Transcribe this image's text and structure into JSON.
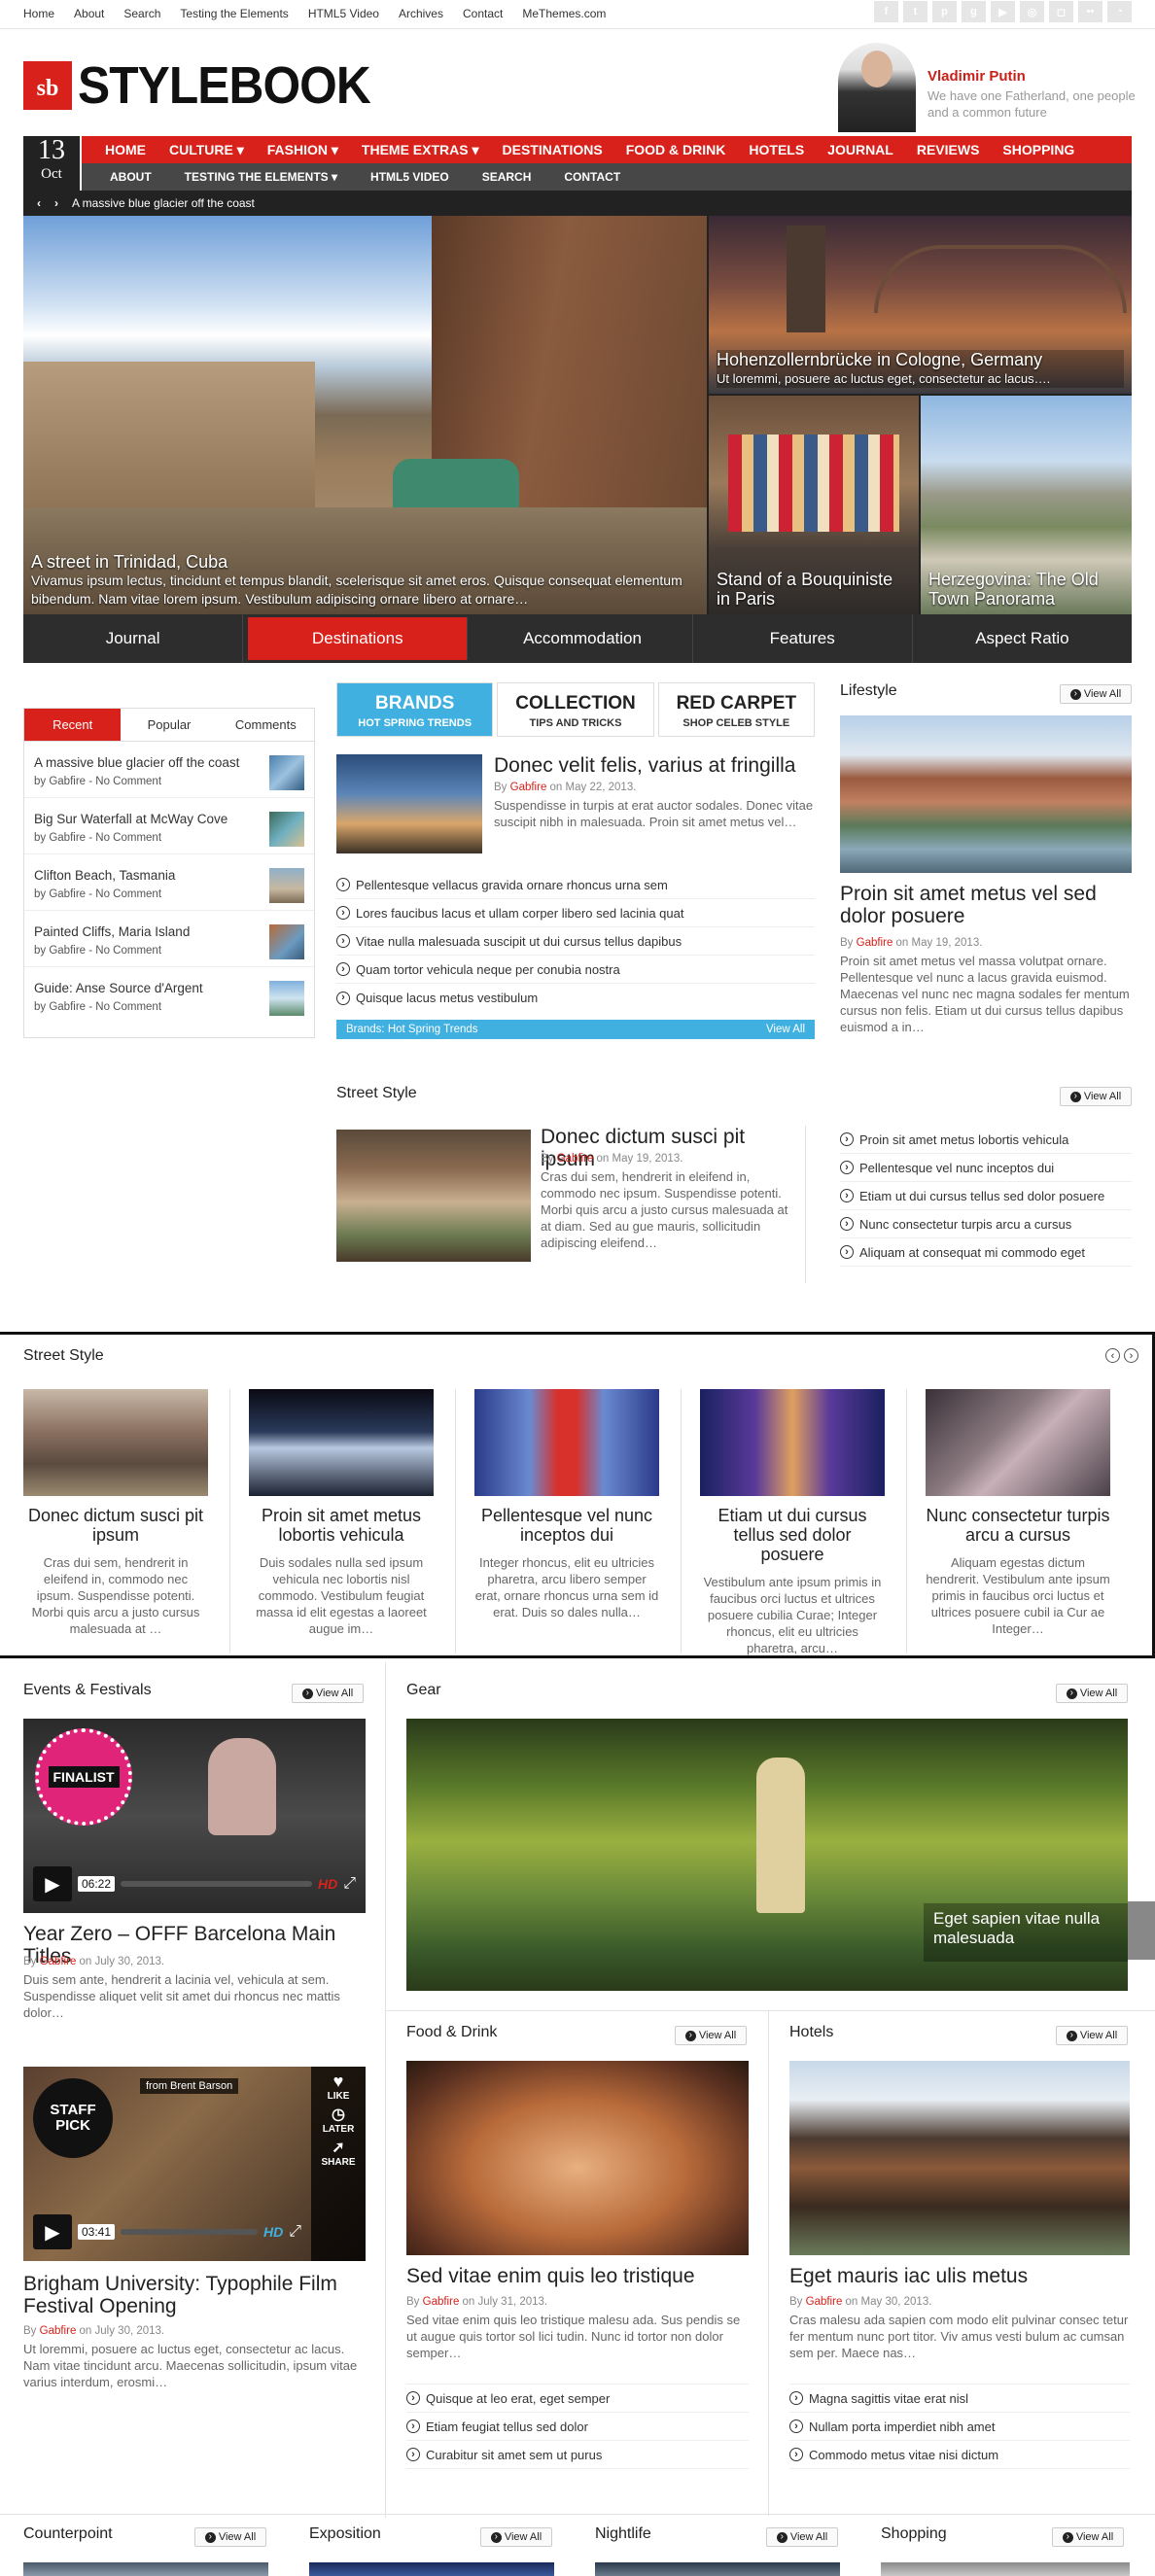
{
  "topbar": {
    "links": [
      "Home",
      "About",
      "Search",
      "Testing the Elements",
      "HTML5 Video",
      "Archives",
      "Contact",
      "MeThemes.com"
    ],
    "social_icons": [
      "facebook-icon",
      "twitter-icon",
      "pinterest-icon",
      "google-plus-icon",
      "youtube-icon",
      "dribbble-icon",
      "instagram-icon",
      "flickr-icon",
      "rss-icon"
    ]
  },
  "logo": {
    "mark": "sb",
    "text": "STYLEBOOK"
  },
  "quote": {
    "name": "Vladimir Putin",
    "text": "We have one Fatherland, one people and a common future"
  },
  "date": {
    "day": "13",
    "month": "Oct"
  },
  "nav": {
    "primary": [
      "HOME",
      "CULTURE ▾",
      "FASHION ▾",
      "THEME EXTRAS ▾",
      "DESTINATIONS",
      "FOOD & DRINK",
      "HOTELS",
      "JOURNAL",
      "REVIEWS",
      "SHOPPING"
    ],
    "secondary": [
      "ABOUT",
      "TESTING THE ELEMENTS ▾",
      "HTML5 VIDEO",
      "SEARCH",
      "CONTACT"
    ]
  },
  "ticker": {
    "prev": "‹",
    "next": "›",
    "text": "A massive blue glacier off the coast"
  },
  "slider": {
    "main": {
      "title": "A street in Trinidad, Cuba",
      "text": "Vivamus ipsum lectus, tincidunt et tempus blandit, scelerisque sit amet eros. Quisque consequat elementum bibendum. Nam vitae lorem ipsum. Vestibulum adipiscing ornare libero at ornare…"
    },
    "top_right": {
      "title": "Hohenzollernbrücke in Cologne, Germany",
      "text": "Ut loremmi, posuere ac luctus eget, consectetur ac lacus…."
    },
    "bottom_left": {
      "title": "Stand of a Bouquiniste in Paris"
    },
    "bottom_right": {
      "title": "Herzegovina: The Old Town Panorama"
    },
    "tabs": [
      "Journal",
      "Destinations",
      "Accommodation",
      "Features",
      "Aspect Ratio"
    ]
  },
  "sidebar": {
    "tabs": [
      "Recent",
      "Popular",
      "Comments"
    ],
    "items": [
      {
        "title": "A massive blue glacier off the coast",
        "meta": "by Gabfire - No Comment"
      },
      {
        "title": "Big Sur Waterfall at McWay Cove",
        "meta": "by Gabfire - No Comment"
      },
      {
        "title": "Clifton Beach, Tasmania",
        "meta": "by Gabfire - No Comment"
      },
      {
        "title": "Painted Cliffs, Maria Island",
        "meta": "by Gabfire - No Comment"
      },
      {
        "title": "Guide: Anse Source d'Argent",
        "meta": "by Gabfire - No Comment"
      }
    ]
  },
  "brands": {
    "tabs": [
      {
        "title": "BRANDS",
        "sub": "HOT SPRING TRENDS"
      },
      {
        "title": "COLLECTION",
        "sub": "TIPS AND TRICKS"
      },
      {
        "title": "RED CARPET",
        "sub": "SHOP CELEB STYLE"
      }
    ],
    "post": {
      "title": "Donec velit felis, varius at fringilla",
      "by": "By ",
      "author": "Gabfire",
      "date": " on May 22, 2013.",
      "excerpt": "Suspendisse in turpis at erat auctor sodales. Donec vitae suscipit nibh in malesuada. Proin sit amet metus vel…"
    },
    "bullets": [
      "Pellentesque vellacus gravida ornare rhoncus urna sem",
      "Lores faucibus lacus et ullam corper libero sed lacinia quat",
      "Vitae nulla malesuada suscipit ut dui cursus tellus dapibus",
      "Quam tortor vehicula neque per conubia nostra",
      "Quisque lacus metus vestibulum"
    ],
    "bar_label": "Brands: Hot Spring Trends",
    "bar_link": "View All"
  },
  "lifestyle": {
    "heading": "Lifestyle",
    "view_all": "View All",
    "title": "Proin sit amet metus vel sed dolor posuere",
    "by": "By ",
    "author": "Gabfire",
    "date": " on May 19, 2013.",
    "excerpt": "Proin sit amet metus vel massa volutpat ornare. Pellentesque vel nunc a lacus gravida euismod. Maecenas vel nunc nec magna sodales fer mentum cursus non felis. Etiam ut dui cursus tellus dapibus euismod a in…"
  },
  "street": {
    "heading": "Street Style",
    "view_all": "View All",
    "title": "Donec dictum susci pit ipsum",
    "by": "By ",
    "author": "Gabfire",
    "date": " on May 19, 2013.",
    "excerpt": "Cras dui sem, hendrerit in eleifend in, commodo nec ipsum. Suspendisse potenti. Morbi quis arcu a justo cursus malesuada at at diam. Sed au gue mauris, sollicitudin adipiscing eleifend…",
    "bullets": [
      "Proin sit amet metus lobortis vehicula",
      "Pellentesque vel nunc inceptos dui",
      "Etiam ut dui cursus tellus sed dolor posuere",
      "Nunc consectetur turpis arcu a cursus",
      "Aliquam at consequat mi commodo eget"
    ]
  },
  "carousel": {
    "heading": "Street Style",
    "items": [
      {
        "title": "Donec dictum susci pit ipsum",
        "text": "Cras dui sem, hendrerit in eleifend in, commodo nec ipsum. Suspendisse potenti. Morbi quis arcu a justo cursus malesuada at …"
      },
      {
        "title": "Proin sit amet metus lobortis vehicula",
        "text": "Duis sodales nulla sed ipsum vehicula nec lobortis nisl commodo. Vestibulum feugiat massa id elit egestas a laoreet augue im…"
      },
      {
        "title": "Pellentesque vel nunc inceptos dui",
        "text": "Integer rhoncus, elit eu ultricies pharetra, arcu libero semper erat, ornare rhoncus urna sem id erat. Duis so dales nulla…"
      },
      {
        "title": "Etiam ut dui cursus tellus sed dolor posuere",
        "text": "Vestibulum ante ipsum primis in faucibus orci luctus et ultrices posuere cubilia Curae; Integer rhoncus, elit eu ultricies pharetra, arcu…"
      },
      {
        "title": "Nunc consectetur turpis arcu a cursus",
        "text": "Aliquam egestas dictum hendrerit. Vestibulum ante ipsum primis in faucibus orci luctus et ultrices posuere cubil ia Cur ae Integer…"
      }
    ]
  },
  "events": {
    "heading": "Events & Festivals",
    "view_all": "View All",
    "video1": {
      "badge": "FINALIST",
      "time": "06:22",
      "hd": "HD",
      "title": "Year Zero – OFFF Barcelona Main Titles",
      "by": "By ",
      "author": "Gabfire",
      "date": " on July 30, 2013.",
      "excerpt": "Duis sem ante, hendrerit a lacinia vel, vehicula at sem. Suspendisse aliquet velit sit amet dui rhoncus nec mattis dolor…"
    },
    "video2": {
      "badge": "STAFF PICK",
      "from": "from Brent Barson",
      "like": "LIKE",
      "later": "LATER",
      "share": "SHARE",
      "time": "03:41",
      "hd": "HD",
      "title": "Brigham University: Typophile Film Festival Opening",
      "by": "By ",
      "author": "Gabfire",
      "date": " on July 30, 2013.",
      "excerpt": "Ut loremmi, posuere ac luctus eget, consectetur ac lacus. Nam vitae tincidunt arcu. Maecenas sollicitudin, ipsum vitae varius interdum, erosmi…"
    }
  },
  "gear": {
    "heading": "Gear",
    "view_all": "View All",
    "caption": "Eget sapien vitae nulla malesuada"
  },
  "food": {
    "heading": "Food & Drink",
    "view_all": "View All",
    "title": "Sed vitae enim quis leo tristique",
    "by": "By ",
    "author": "Gabfire",
    "date": " on July 31, 2013.",
    "excerpt": "Sed vitae enim quis leo tristique malesu ada. Sus pendis se ut augue quis tortor sol lici tudin. Nunc id tortor non dolor semper…",
    "bullets": [
      "Quisque at leo erat, eget semper",
      "Etiam feugiat tellus sed dolor",
      "Curabitur sit amet sem ut purus"
    ]
  },
  "hotels": {
    "heading": "Hotels",
    "view_all": "View All",
    "title": "Eget mauris iac ulis metus",
    "by": "By ",
    "author": "Gabfire",
    "date": " on May 30, 2013.",
    "excerpt": "Cras malesu ada sapien com modo elit pulvinar consec tetur fer mentum nunc port titor. Viv amus vesti bulum ac cumsan sem per. Maece nas…",
    "bullets": [
      "Magna sagittis vitae erat nisl",
      "Nullam porta imperdiet nibh amet",
      "Commodo metus vitae nisi dictum"
    ]
  },
  "bottom": {
    "sections": [
      "Counterpoint",
      "Exposition",
      "Nightlife",
      "Shopping"
    ],
    "view_all": "View All"
  },
  "colors": {
    "accent": "#d8211a",
    "blue": "#3fb0e0",
    "dark": "#222222"
  }
}
